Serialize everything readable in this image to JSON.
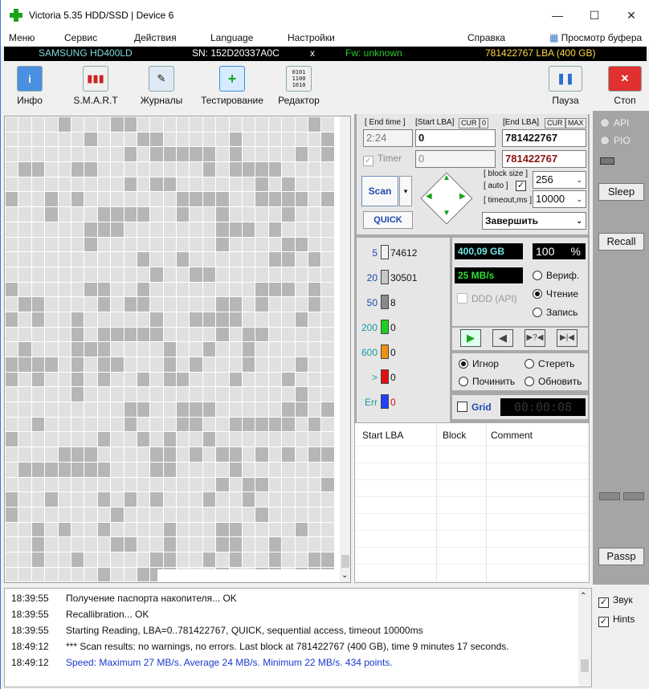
{
  "window": {
    "title": "Victoria 5.35 HDD/SSD | Device 6",
    "min": "—",
    "max": "☐",
    "close": "✕"
  },
  "menu": [
    "Меню",
    "Сервис",
    "Действия",
    "Language",
    "Настройки",
    "Справка",
    "Просмотр буфера"
  ],
  "device": {
    "model": "SAMSUNG HD400LD",
    "serial": "SN: 152D20337A0C",
    "x": "x",
    "fw": "Fw: unknown",
    "lba": "781422767 LBA (400 GB)"
  },
  "toolbar": [
    {
      "label": "Инфо",
      "icon": "info-icon"
    },
    {
      "label": "S.M.A.R.T",
      "icon": "smart-icon"
    },
    {
      "label": "Журналы",
      "icon": "journal-icon"
    },
    {
      "label": "Тестирование",
      "icon": "test-icon"
    },
    {
      "label": "Редактор",
      "icon": "editor-icon"
    },
    {
      "label": "Пауза",
      "icon": "pause-icon"
    },
    {
      "label": "Стоп",
      "icon": "stop-icon"
    }
  ],
  "right_panel": {
    "api": "API",
    "pio": "PIO",
    "sleep": "Sleep",
    "recall": "Recall",
    "passp": "Passp"
  },
  "scan": {
    "end_time_label": "[ End time ]",
    "start_lba_label": "[Start LBA]",
    "cur": "CUR",
    "zero": "0",
    "end_lba_label": "[End LBA]",
    "cur2": "CUR",
    "max": "MAX",
    "end_time": "2:24",
    "start_lba": "0",
    "end_lba": "781422767",
    "timer_label": "Timer",
    "timer_value": "0",
    "end_lba2": "781422767",
    "scan_btn": "Scan",
    "quick_btn": "QUICK",
    "block_size_label": "[ block size ]",
    "auto_label": "[ auto ]",
    "timeout_label": "[ timeout,ms ]",
    "block_size": "256",
    "timeout": "10000",
    "finish": "Завершить"
  },
  "legend": [
    {
      "ms": "5",
      "count": "74612",
      "color": "#f2f2f2"
    },
    {
      "ms": "20",
      "count": "30501",
      "color": "#c8c8c8"
    },
    {
      "ms": "50",
      "count": "8",
      "color": "#8a8a8a"
    },
    {
      "ms": "200",
      "count": "0",
      "color": "#1ed01e"
    },
    {
      "ms": "600",
      "count": "0",
      "color": "#f09010"
    },
    {
      "ms": ">",
      "count": "0",
      "color": "#e01010"
    },
    {
      "ms": "Err",
      "count": "0",
      "color": "#2040ff"
    }
  ],
  "stats": {
    "size": "400,09 GB",
    "percent": "100",
    "pct_sign": "%",
    "speed": "25 MB/s",
    "ddd": "DDD (API)",
    "verify": "Вериф.",
    "read": "Чтение",
    "write": "Запись"
  },
  "repair": {
    "ignore": "Игнор",
    "erase": "Стереть",
    "fix": "Починить",
    "refresh": "Обновить",
    "grid": "Grid",
    "clock": "00:00:08"
  },
  "table": {
    "headers": [
      "Start LBA",
      "Block",
      "Comment"
    ]
  },
  "options": {
    "sound": "Звук",
    "hints": "Hints"
  },
  "log": [
    {
      "time": "18:39:55",
      "text": "Получение паспорта накопителя... OK",
      "color": "#111"
    },
    {
      "time": "18:39:55",
      "text": "Recallibration... OK",
      "color": "#111"
    },
    {
      "time": "18:39:55",
      "text": "Starting Reading, LBA=0..781422767, QUICK, sequential access, timeout 10000ms",
      "color": "#111"
    },
    {
      "time": "18:49:12",
      "text": "*** Scan results: no warnings, no errors. Last block at 781422767 (400 GB), time 9 minutes 17 seconds.",
      "color": "#111"
    },
    {
      "time": "18:49:12",
      "text": "Speed: Maximum 27 MB/s. Average 24 MB/s. Minimum 22 MB/s. 434 points.",
      "color": "#1a3acc"
    }
  ]
}
